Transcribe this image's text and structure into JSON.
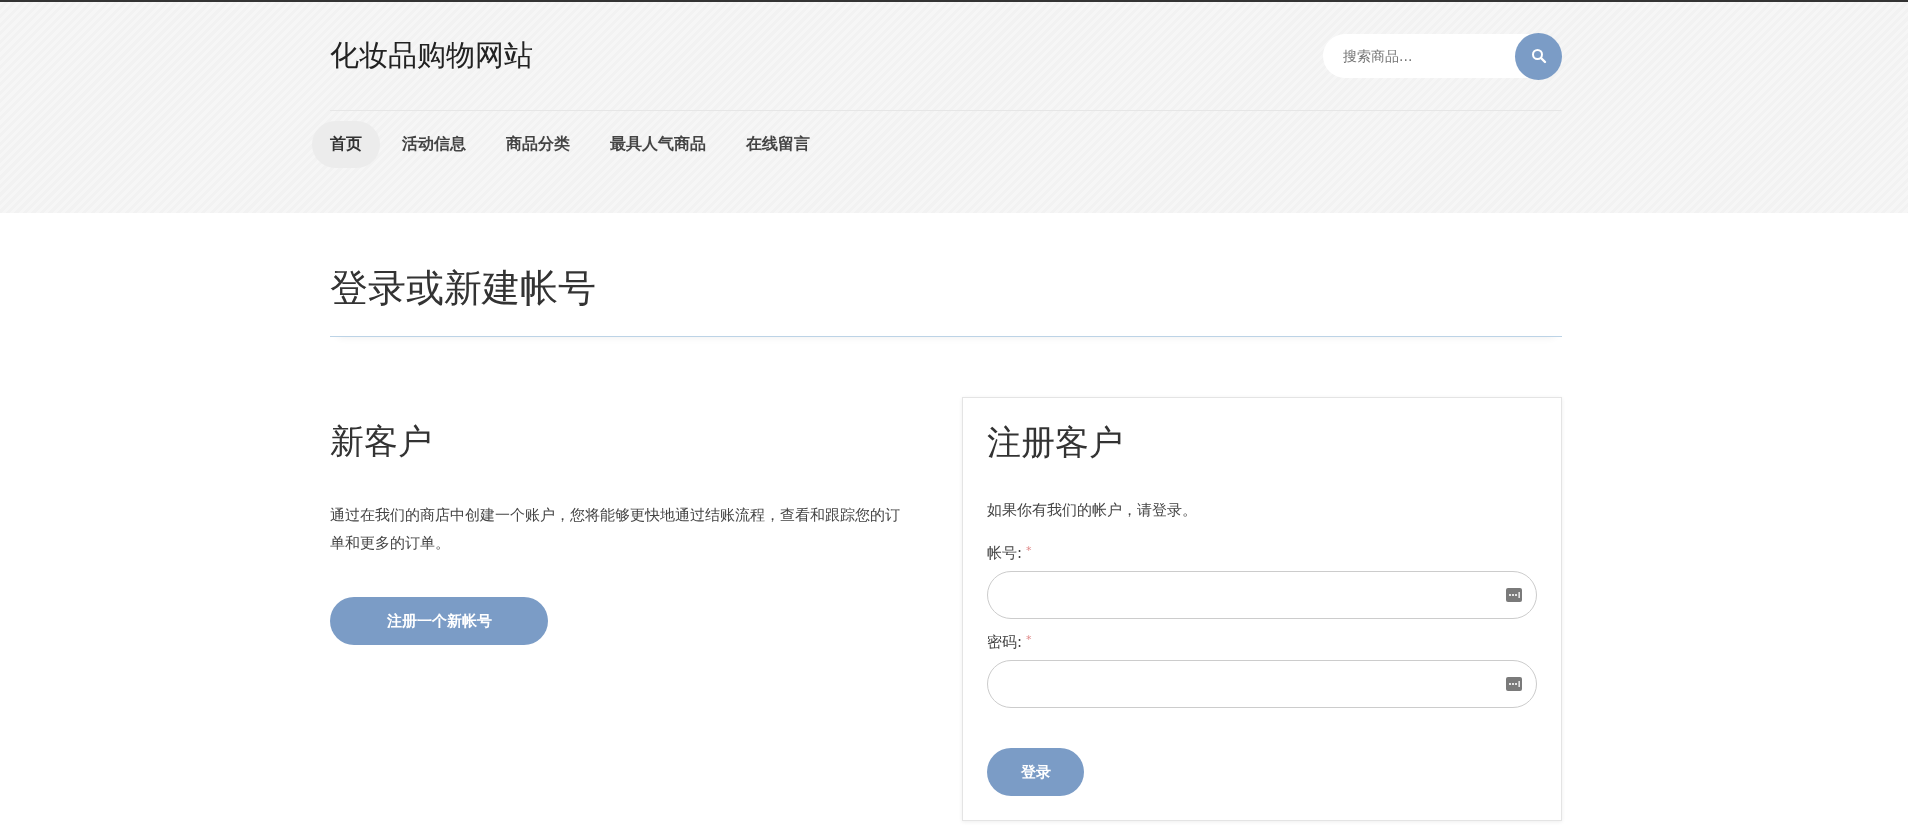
{
  "header": {
    "site_title": "化妆品购物网站",
    "search": {
      "placeholder": "搜索商品..."
    }
  },
  "nav": [
    {
      "label": "首页",
      "selected": true
    },
    {
      "label": "活动信息",
      "selected": false
    },
    {
      "label": "商品分类",
      "selected": false
    },
    {
      "label": "最具人气商品",
      "selected": false
    },
    {
      "label": "在线留言",
      "selected": false
    }
  ],
  "page_title": "登录或新建帐号",
  "new_customer": {
    "heading": "新客户",
    "text": "通过在我们的商店中创建一个账户，您将能够更快地通过结账流程，查看和跟踪您的订单和更多的订单。",
    "button": "注册一个新帐号"
  },
  "login": {
    "heading": "注册客户",
    "text": "如果你有我们的帐户，请登录。",
    "fields": [
      {
        "label": "帐号:",
        "required_mark": "*"
      },
      {
        "label": "密码:",
        "required_mark": "*"
      }
    ],
    "button": "登录"
  }
}
